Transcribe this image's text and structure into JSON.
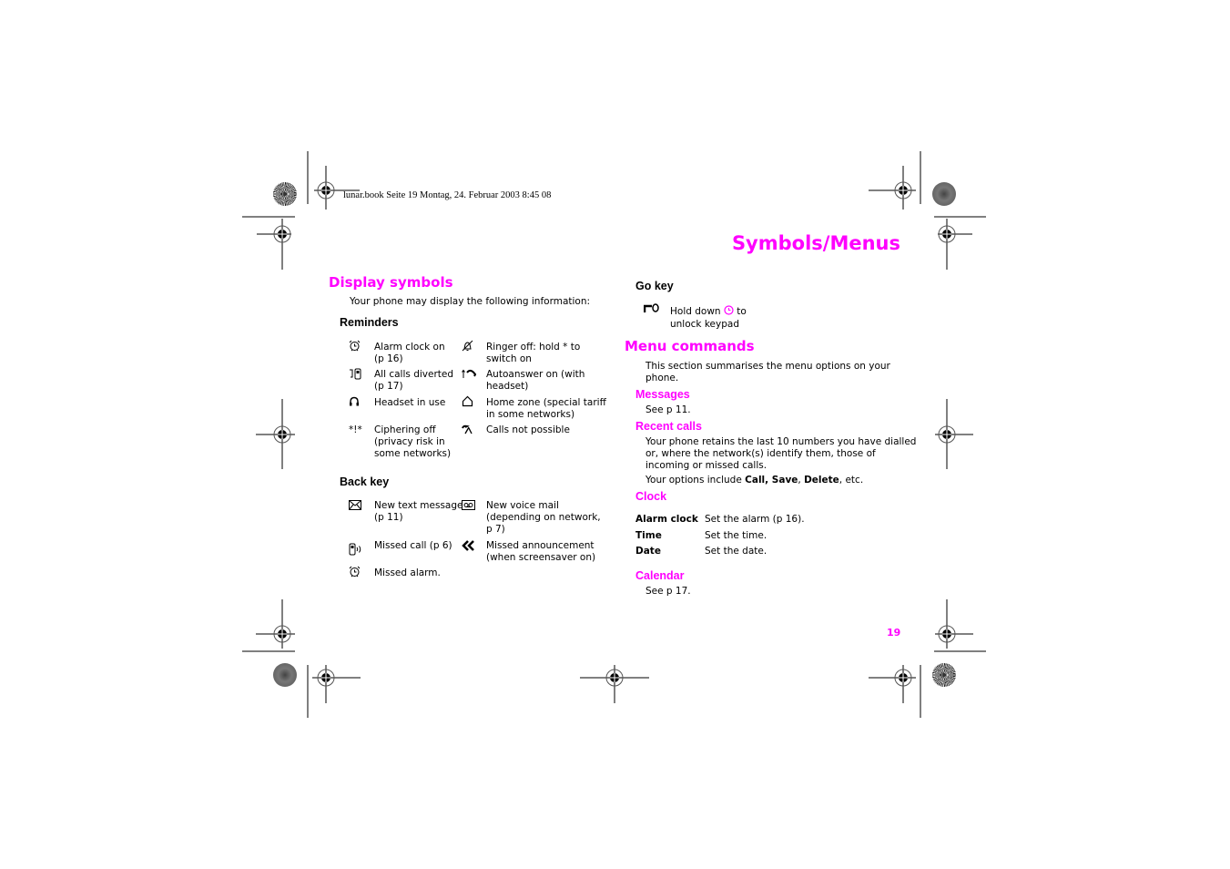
{
  "header": {
    "running_line": "lunar.book  Seite 19  Montag, 24. Februar 2003  8:45 08"
  },
  "page_title": "Symbols/Menus",
  "display_symbols": {
    "heading": "Display symbols",
    "intro": "Your phone may display the following information:",
    "reminders": {
      "heading": "Reminders",
      "items": [
        {
          "icon": "alarm-clock-icon",
          "glyph": "⏰",
          "line1": " Alarm clock on",
          "line2": "(p 16)"
        },
        {
          "icon": "ringer-off-icon",
          "glyph": "🔕",
          "line1": "Ringer off: hold * to",
          "line2": "switch on"
        },
        {
          "icon": "call-divert-icon",
          "glyph": "⊐▯",
          "line1": "All calls diverted",
          "line2": "(p 17)"
        },
        {
          "icon": "autoanswer-icon",
          "glyph": "↿↷",
          "line1": "Autoanswer on (with",
          "line2": "headset)"
        },
        {
          "icon": "headset-icon",
          "glyph": "Ω",
          "line1": "Headset in use",
          "line2": ""
        },
        {
          "icon": "home-zone-icon",
          "glyph": "⌂",
          "line1": "Home zone (special tariff",
          "line2": "in some networks)"
        },
        {
          "icon": "ciphering-off-icon",
          "glyph": "*!*",
          "line1": "Ciphering off",
          "line2": "(privacy risk in",
          "line3": "some networks)"
        },
        {
          "icon": "calls-not-possible-icon",
          "glyph": "⌐̸",
          "line1": "Calls not possible",
          "line2": ""
        }
      ]
    },
    "back_key": {
      "heading": "Back key",
      "items": [
        {
          "icon": "envelope-icon",
          "glyph": "✉",
          "line1": "New text message",
          "line2": "(p 11)"
        },
        {
          "icon": "voicemail-icon",
          "glyph": "⊡",
          "line1": "New voice mail",
          "line2": "(depending on network,",
          "line3": "p 7)"
        },
        {
          "icon": "missed-call-icon",
          "glyph": "▯))",
          "line1": "Missed call (p 6)",
          "line2": ""
        },
        {
          "icon": "missed-announcement-icon",
          "glyph": "«",
          "line1": "Missed announcement",
          "line2": "(when screensaver on)"
        },
        {
          "icon": "missed-alarm-icon",
          "glyph": "⏰",
          "line1": "Missed alarm.",
          "line2": ""
        }
      ]
    }
  },
  "go_key": {
    "heading": "Go key",
    "icon": "key-lock-icon",
    "glyph": "⌐0",
    "line1_pre": "Hold down ",
    "line1_post": " to",
    "line2": "unlock keypad",
    "accent_symbol": "◷"
  },
  "menu_commands": {
    "heading": "Menu commands",
    "intro_line1": "This section summarises the menu options on your",
    "intro_line2": "phone.",
    "messages": {
      "heading": "Messages",
      "text": "See p 11."
    },
    "recent_calls": {
      "heading": "Recent calls",
      "line1": "Your phone retains the last 10 numbers you have dialled",
      "line2": "or, where the network(s) identify them, those of",
      "line3": "incoming or missed calls.",
      "options_pre": "Your options include ",
      "options_bold1": "Call, Save",
      "options_sep": ", ",
      "options_bold2": "Delete",
      "options_post": ", etc."
    },
    "clock": {
      "heading": "Clock",
      "rows": [
        {
          "term": "Alarm clock",
          "desc": "Set the alarm (p 16)."
        },
        {
          "term": "Time",
          "desc": "Set the time."
        },
        {
          "term": "Date",
          "desc": "Set the date."
        }
      ]
    },
    "calendar": {
      "heading": "Calendar",
      "text": "See p 17."
    }
  },
  "page_number": "19",
  "colors": {
    "accent": "#ff00ff",
    "text": "#000000"
  }
}
